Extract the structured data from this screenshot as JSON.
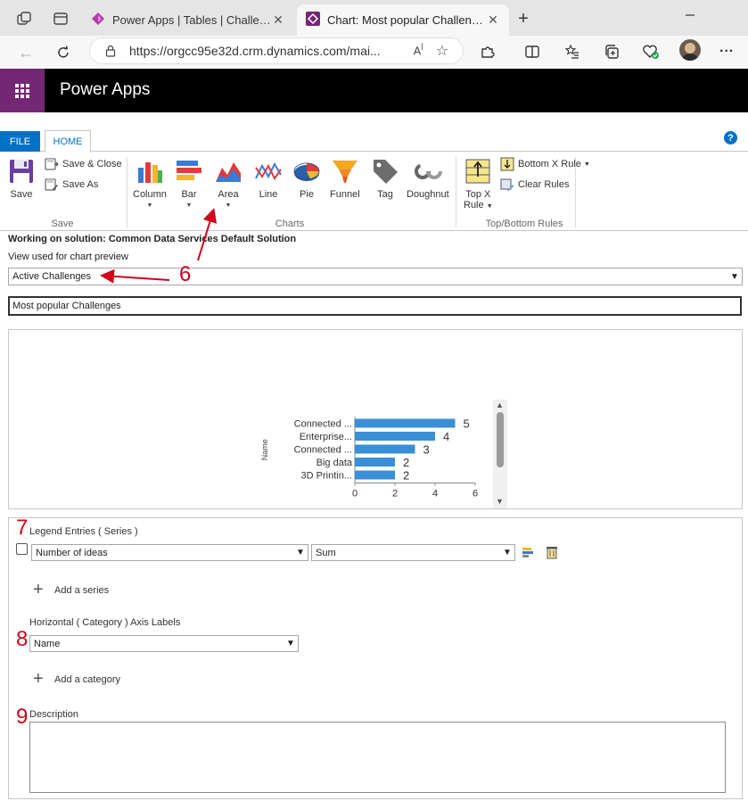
{
  "browser": {
    "tabs": [
      {
        "title": "Power Apps | Tables | Challenge |",
        "active": false
      },
      {
        "title": "Chart: Most popular Challenges",
        "active": true
      }
    ],
    "url": "https://orgcc95e32d.crm.dynamics.com/mai..."
  },
  "app": {
    "name": "Power Apps"
  },
  "ribbon": {
    "tabs": {
      "file": "FILE",
      "home": "HOME"
    },
    "save_group": {
      "label": "Save",
      "save": "Save",
      "save_close": "Save & Close",
      "save_as": "Save As"
    },
    "charts_group": {
      "label": "Charts",
      "items": [
        {
          "label": "Column",
          "icon": "column-chart-icon",
          "dropdown": true
        },
        {
          "label": "Bar",
          "icon": "bar-chart-icon",
          "dropdown": true
        },
        {
          "label": "Area",
          "icon": "area-chart-icon",
          "dropdown": true
        },
        {
          "label": "Line",
          "icon": "line-chart-icon",
          "dropdown": false
        },
        {
          "label": "Pie",
          "icon": "pie-chart-icon",
          "dropdown": false
        },
        {
          "label": "Funnel",
          "icon": "funnel-chart-icon",
          "dropdown": false
        },
        {
          "label": "Tag",
          "icon": "tag-chart-icon",
          "dropdown": false
        },
        {
          "label": "Doughnut",
          "icon": "doughnut-chart-icon",
          "dropdown": false
        }
      ]
    },
    "rules_group": {
      "label": "Top/Bottom Rules",
      "top_x_line1": "Top X",
      "top_x_line2": "Rule",
      "bottom_x": "Bottom X Rule",
      "clear_rules": "Clear Rules"
    }
  },
  "form": {
    "solution_text": "Working on solution: Common Data Services Default Solution",
    "view_label": "View used for chart preview",
    "view_value": "Active Challenges",
    "chart_name": "Most popular Challenges",
    "legend_label": "Legend Entries ( Series )",
    "series_field": "Number of ideas",
    "series_aggregate": "Sum",
    "add_series": "Add a series",
    "category_label": "Horizontal ( Category ) Axis Labels",
    "category_field": "Name",
    "add_category": "Add a category",
    "description_label": "Description",
    "description_value": ""
  },
  "annotations": {
    "six": "6",
    "seven": "7",
    "eight": "8",
    "nine": "9"
  },
  "chart_data": {
    "type": "bar",
    "orientation": "horizontal",
    "categories": [
      "Connected ...",
      "Enterprise...",
      "Connected ...",
      "Big data",
      "3D Printin..."
    ],
    "values": [
      5,
      4,
      3,
      2,
      2
    ],
    "ylabel": "Name",
    "xlim": [
      0,
      6
    ],
    "xticks": [
      0,
      2,
      4,
      6
    ],
    "bar_color": "#3a8fd6"
  },
  "colors": {
    "brand": "#742774",
    "accent": "#0072c6",
    "annotation": "#d0021b"
  }
}
